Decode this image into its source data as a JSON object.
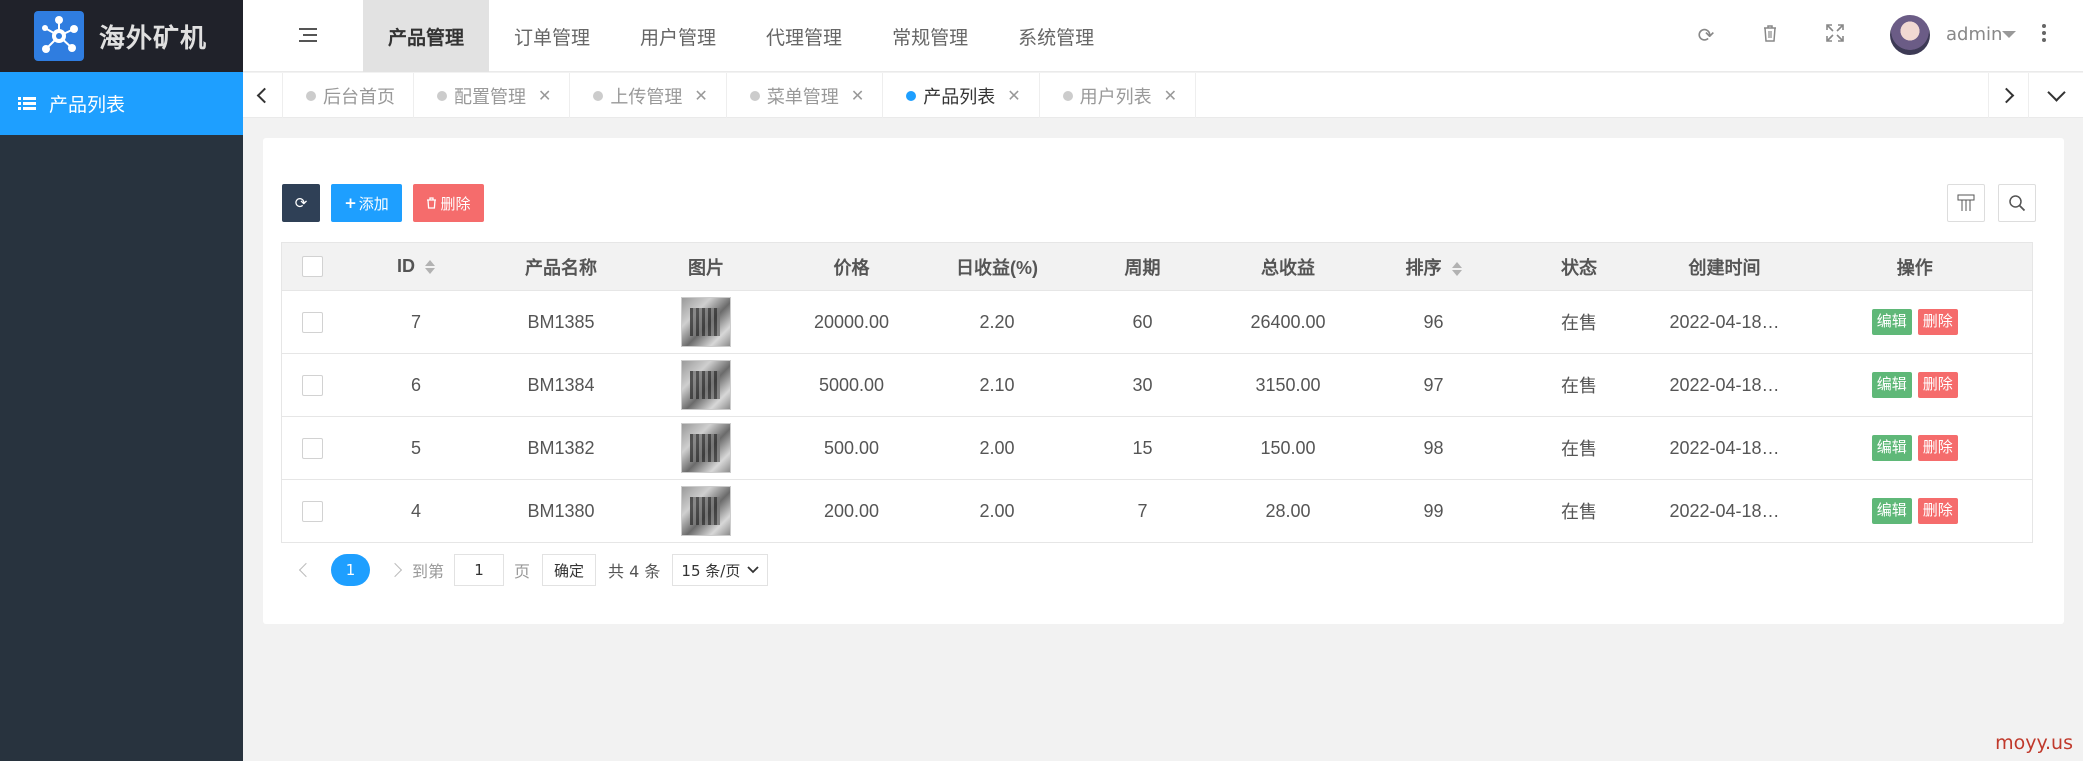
{
  "app": {
    "title": "海外矿机"
  },
  "sidebar": {
    "items": [
      {
        "label": "产品列表",
        "icon": "list-icon"
      }
    ]
  },
  "topnav": {
    "items": [
      "产品管理",
      "订单管理",
      "用户管理",
      "代理管理",
      "常规管理",
      "系统管理"
    ],
    "active": "产品管理"
  },
  "header": {
    "user": "admin"
  },
  "tabs": [
    {
      "label": "后台首页",
      "closable": false
    },
    {
      "label": "配置管理",
      "closable": true
    },
    {
      "label": "上传管理",
      "closable": true
    },
    {
      "label": "菜单管理",
      "closable": true
    },
    {
      "label": "产品列表",
      "closable": true,
      "active": true
    },
    {
      "label": "用户列表",
      "closable": true
    }
  ],
  "toolbar": {
    "add_label": "添加",
    "delete_label": "删除"
  },
  "table": {
    "columns": [
      "ID",
      "产品名称",
      "图片",
      "价格",
      "日收益(%)",
      "周期",
      "总收益",
      "排序",
      "状态",
      "创建时间",
      "操作"
    ],
    "rows": [
      {
        "id": "7",
        "name": "BM1385",
        "price": "20000.00",
        "daily": "2.20",
        "period": "60",
        "total": "26400.00",
        "sort": "96",
        "status": "在售",
        "created": "2022-04-18…"
      },
      {
        "id": "6",
        "name": "BM1384",
        "price": "5000.00",
        "daily": "2.10",
        "period": "30",
        "total": "3150.00",
        "sort": "97",
        "status": "在售",
        "created": "2022-04-18…"
      },
      {
        "id": "5",
        "name": "BM1382",
        "price": "500.00",
        "daily": "2.00",
        "period": "15",
        "total": "150.00",
        "sort": "98",
        "status": "在售",
        "created": "2022-04-18…"
      },
      {
        "id": "4",
        "name": "BM1380",
        "price": "200.00",
        "daily": "2.00",
        "period": "7",
        "total": "28.00",
        "sort": "99",
        "status": "在售",
        "created": "2022-04-18…"
      }
    ],
    "actions": {
      "edit": "编辑",
      "delete": "删除"
    }
  },
  "pagination": {
    "current": "1",
    "goto_label": "到第",
    "page_input": "1",
    "page_label": "页",
    "confirm": "确定",
    "total": "共 4 条",
    "page_size": "15 条/页"
  },
  "watermark": "moyy.us",
  "colors": {
    "primary": "#1e9fff",
    "sidebar": "#28333e",
    "danger": "#f56c6c",
    "success": "#5fb878"
  }
}
